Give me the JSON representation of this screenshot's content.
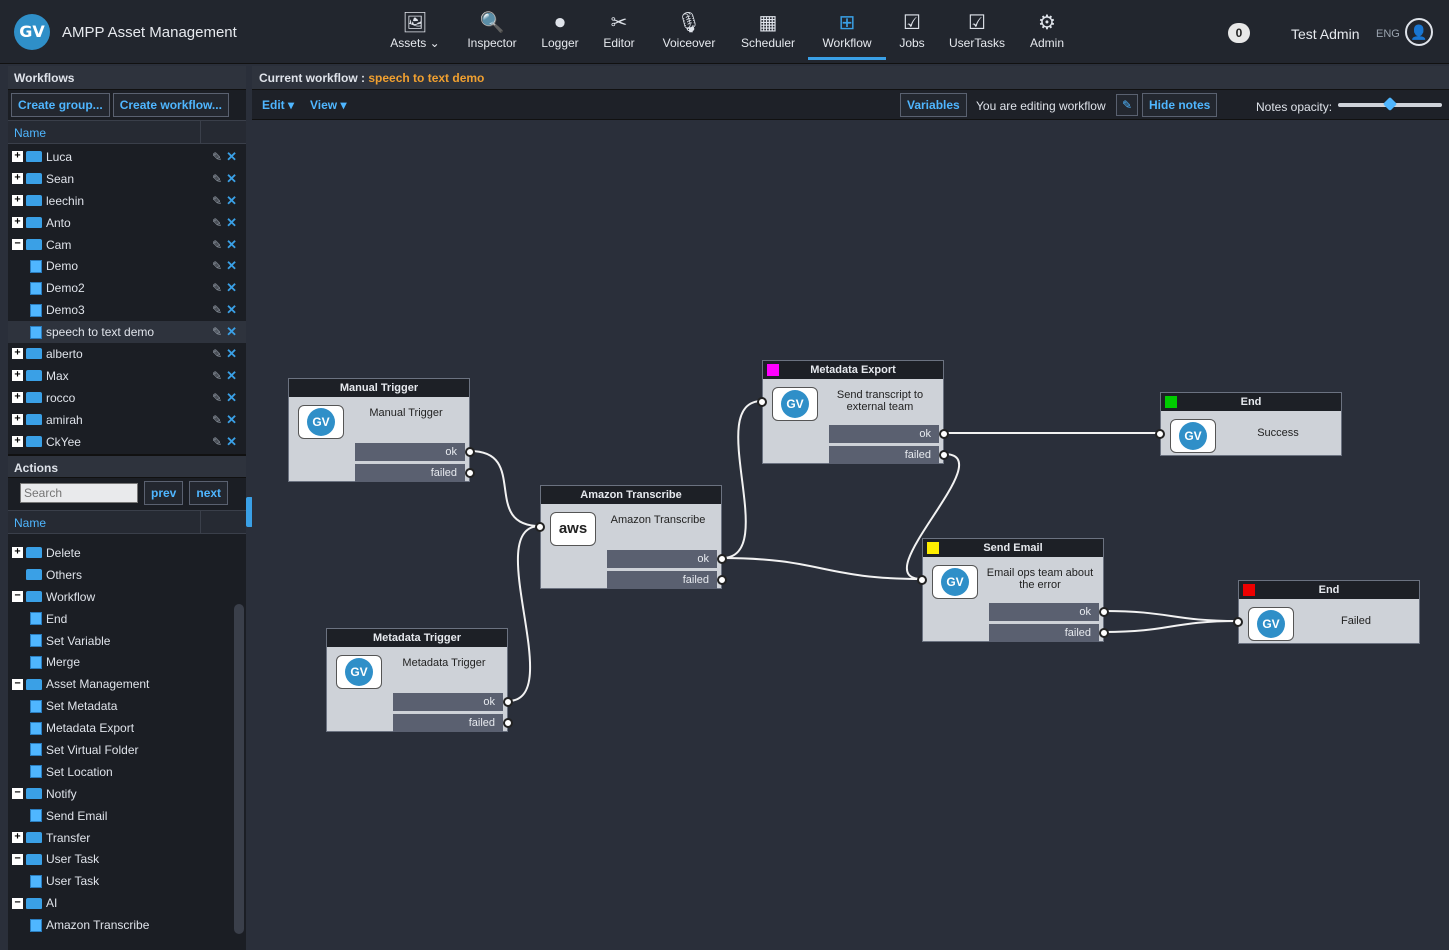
{
  "app": {
    "title": "AMPP Asset Management",
    "logo": "GV"
  },
  "nav": [
    {
      "label": "Assets ⌄",
      "icon": "assets-icon",
      "glyph": "🖼"
    },
    {
      "label": "Inspector",
      "icon": "inspector-icon",
      "glyph": "🔍"
    },
    {
      "label": "Logger",
      "icon": "logger-icon",
      "glyph": "⏺"
    },
    {
      "label": "Editor",
      "icon": "editor-icon",
      "glyph": "✂"
    },
    {
      "label": "Voiceover",
      "icon": "voiceover-icon",
      "glyph": "🎙"
    },
    {
      "label": "Scheduler",
      "icon": "scheduler-icon",
      "glyph": "▦"
    },
    {
      "label": "Workflow",
      "icon": "workflow-icon",
      "glyph": "⊞"
    },
    {
      "label": "Jobs",
      "icon": "jobs-icon",
      "glyph": "☑"
    },
    {
      "label": "UserTasks",
      "icon": "usertasks-icon",
      "glyph": "☑"
    },
    {
      "label": "Admin",
      "icon": "admin-icon",
      "glyph": "⚙"
    }
  ],
  "active_nav": "Workflow",
  "header": {
    "notifications": "0",
    "user": "Test Admin",
    "lang": "ENG"
  },
  "workflows_panel": {
    "title": "Workflows",
    "create_group": "Create group...",
    "create_workflow": "Create workflow...",
    "col_name": "Name",
    "items": [
      {
        "label": "Luca",
        "type": "folder",
        "exp": "+"
      },
      {
        "label": "Sean",
        "type": "folder",
        "exp": "+"
      },
      {
        "label": "leechin",
        "type": "folder",
        "exp": "+"
      },
      {
        "label": "Anto",
        "type": "folder",
        "exp": "+"
      },
      {
        "label": "Cam",
        "type": "folder",
        "exp": "−"
      },
      {
        "label": "Demo",
        "type": "doc"
      },
      {
        "label": "Demo2",
        "type": "doc"
      },
      {
        "label": "Demo3",
        "type": "doc"
      },
      {
        "label": "speech to text demo",
        "type": "doc",
        "selected": true
      },
      {
        "label": "alberto",
        "type": "folder",
        "exp": "+"
      },
      {
        "label": "Max",
        "type": "folder",
        "exp": "+"
      },
      {
        "label": "rocco",
        "type": "folder",
        "exp": "+"
      },
      {
        "label": "amirah",
        "type": "folder",
        "exp": "+"
      },
      {
        "label": "CkYee",
        "type": "folder",
        "exp": "+"
      }
    ]
  },
  "actions_panel": {
    "title": "Actions",
    "search_placeholder": "Search",
    "prev": "prev",
    "next": "next",
    "col_name": "Name",
    "items": [
      {
        "label": "Delete",
        "type": "folder",
        "exp": "+"
      },
      {
        "label": "Others",
        "type": "folder",
        "exp": ""
      },
      {
        "label": "Workflow",
        "type": "folder",
        "exp": "−"
      },
      {
        "label": "End",
        "type": "doc"
      },
      {
        "label": "Set Variable",
        "type": "doc"
      },
      {
        "label": "Merge",
        "type": "doc"
      },
      {
        "label": "Asset Management",
        "type": "folder",
        "exp": "−"
      },
      {
        "label": "Set Metadata",
        "type": "doc"
      },
      {
        "label": "Metadata Export",
        "type": "doc"
      },
      {
        "label": "Set Virtual Folder",
        "type": "doc"
      },
      {
        "label": "Set Location",
        "type": "doc"
      },
      {
        "label": "Notify",
        "type": "folder",
        "exp": "−"
      },
      {
        "label": "Send Email",
        "type": "doc"
      },
      {
        "label": "Transfer",
        "type": "folder",
        "exp": "+"
      },
      {
        "label": "User Task",
        "type": "folder",
        "exp": "−"
      },
      {
        "label": "User Task",
        "type": "doc"
      },
      {
        "label": "AI",
        "type": "folder",
        "exp": "−"
      },
      {
        "label": "Amazon Transcribe",
        "type": "doc"
      }
    ]
  },
  "editor": {
    "current_label": "Current workflow :",
    "workflow_name": "speech to text demo",
    "edit_menu": "Edit ▾",
    "view_menu": "View ▾",
    "variables": "Variables",
    "editing": "You are editing workflow",
    "hide_notes": "Hide notes",
    "notes_opacity": "Notes opacity:",
    "notes_opacity_value": 0.5
  },
  "nodes": [
    {
      "id": "manual",
      "title": "Manual Trigger",
      "desc": "Manual Trigger",
      "icon": "GV",
      "ports": [
        "ok",
        "failed"
      ]
    },
    {
      "id": "metatrig",
      "title": "Metadata Trigger",
      "desc": "Metadata Trigger",
      "icon": "GV",
      "ports": [
        "ok",
        "failed"
      ]
    },
    {
      "id": "transcribe",
      "title": "Amazon Transcribe",
      "desc": "Amazon Transcribe",
      "icon": "aws",
      "ports": [
        "ok",
        "failed"
      ]
    },
    {
      "id": "export",
      "title": "Metadata Export",
      "desc": "Send transcript to external team",
      "icon": "GV",
      "color": "#ff00ff",
      "ports": [
        "ok",
        "failed"
      ]
    },
    {
      "id": "email",
      "title": "Send Email",
      "desc": "Email ops team about the error",
      "icon": "GV",
      "color": "#ffee00",
      "ports": [
        "ok",
        "failed"
      ]
    },
    {
      "id": "success",
      "title": "End",
      "desc": "Success",
      "icon": "GV",
      "color": "#00cc00",
      "ports": []
    },
    {
      "id": "fail",
      "title": "End",
      "desc": "Failed",
      "icon": "GV",
      "color": "#ee0000",
      "ports": []
    }
  ]
}
